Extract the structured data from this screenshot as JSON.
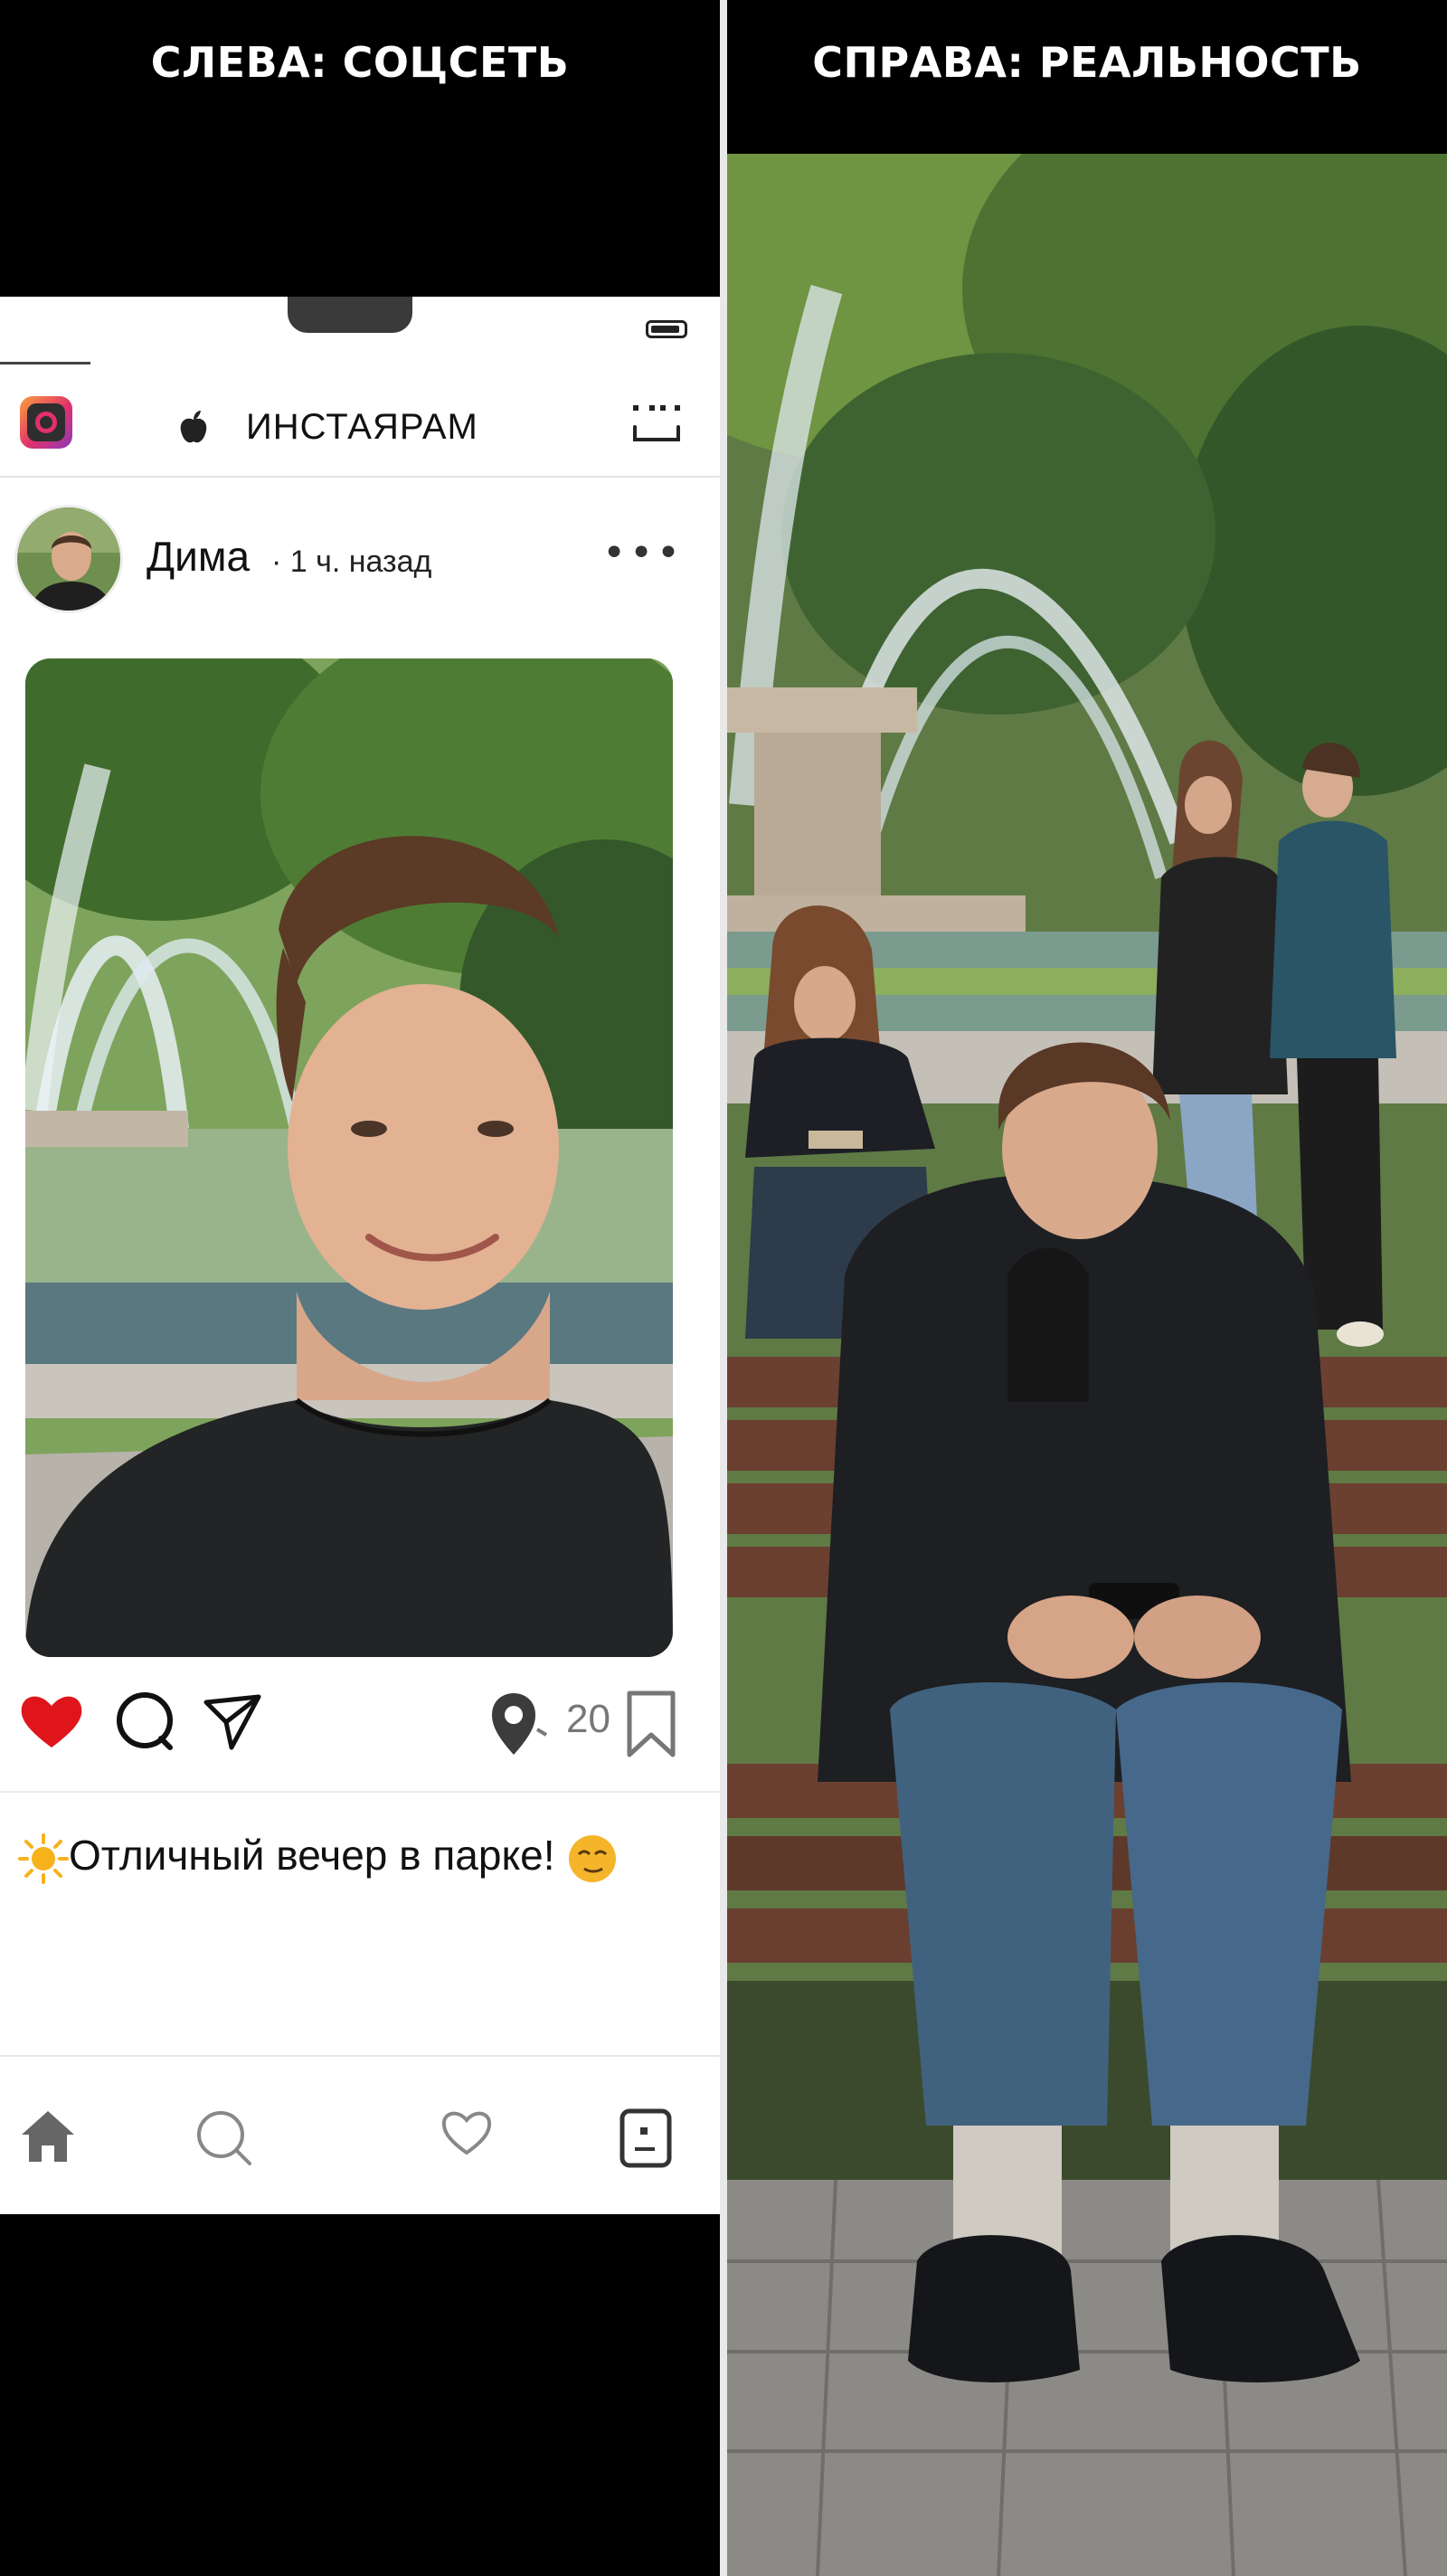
{
  "left_panel": {
    "title": "СЛЕВА: СОЦСЕТЬ"
  },
  "right_panel": {
    "title": "СПРАВА: РЕАЛЬНОСТЬ"
  },
  "app": {
    "title": "ИНСТАЯРАМ"
  },
  "post": {
    "user_name": "Дима",
    "time": "· 1 ч. назад",
    "count": "20",
    "caption": "Отличный вечер в парке!"
  },
  "icons": {
    "logo": "instagram-logo-icon",
    "apple": "apple-icon",
    "dm": "robot-face-icon",
    "more": "more-dots-icon",
    "like": "heart-filled-icon",
    "comment": "comment-icon",
    "share": "send-icon",
    "location": "location-pin-icon",
    "bookmark": "bookmark-icon",
    "home": "home-icon",
    "search": "search-icon",
    "activity": "heart-outline-icon",
    "profile": "profile-icon"
  },
  "colors": {
    "like": "#e0141b",
    "background": "#000000",
    "phone": "#ffffff"
  }
}
